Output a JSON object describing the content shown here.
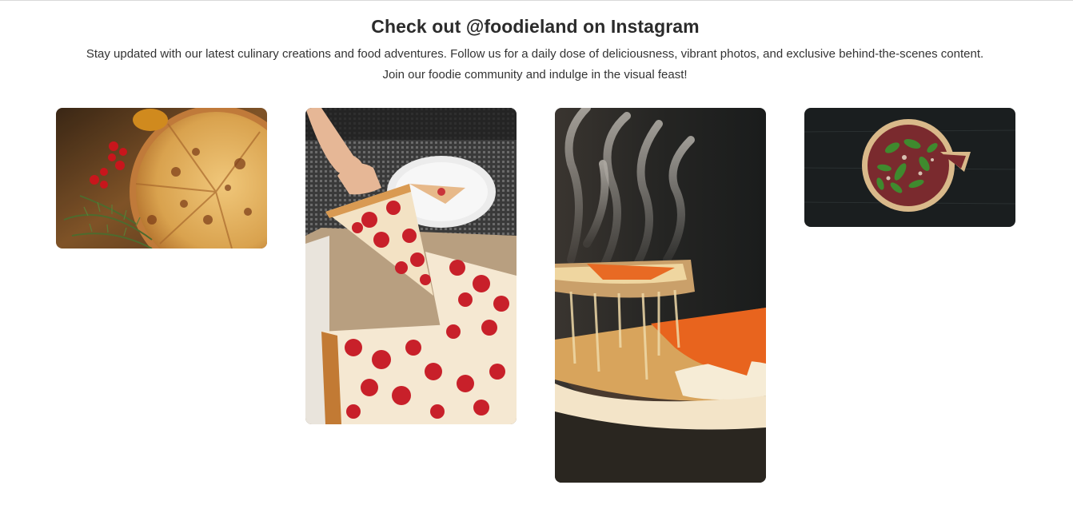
{
  "section": {
    "title": "Check out @foodieland on Instagram",
    "description_line1": "Stay updated with our latest culinary creations and food adventures. Follow us for a daily dose of deliciousness, vibrant photos, and exclusive behind-the-scenes content.",
    "description_line2": "Join our foodie community and indulge in the visual feast!"
  },
  "posts": [
    {
      "subject": "pizza-with-tomatoes-and-rosemary"
    },
    {
      "subject": "pepperoni-pizza-slice"
    },
    {
      "subject": "steaming-cheesy-pizza-slice"
    },
    {
      "subject": "arugula-pizza-on-dark-table"
    }
  ],
  "colors": {
    "heading": "#2b2b2b",
    "body_text": "#333333",
    "background": "#ffffff"
  }
}
